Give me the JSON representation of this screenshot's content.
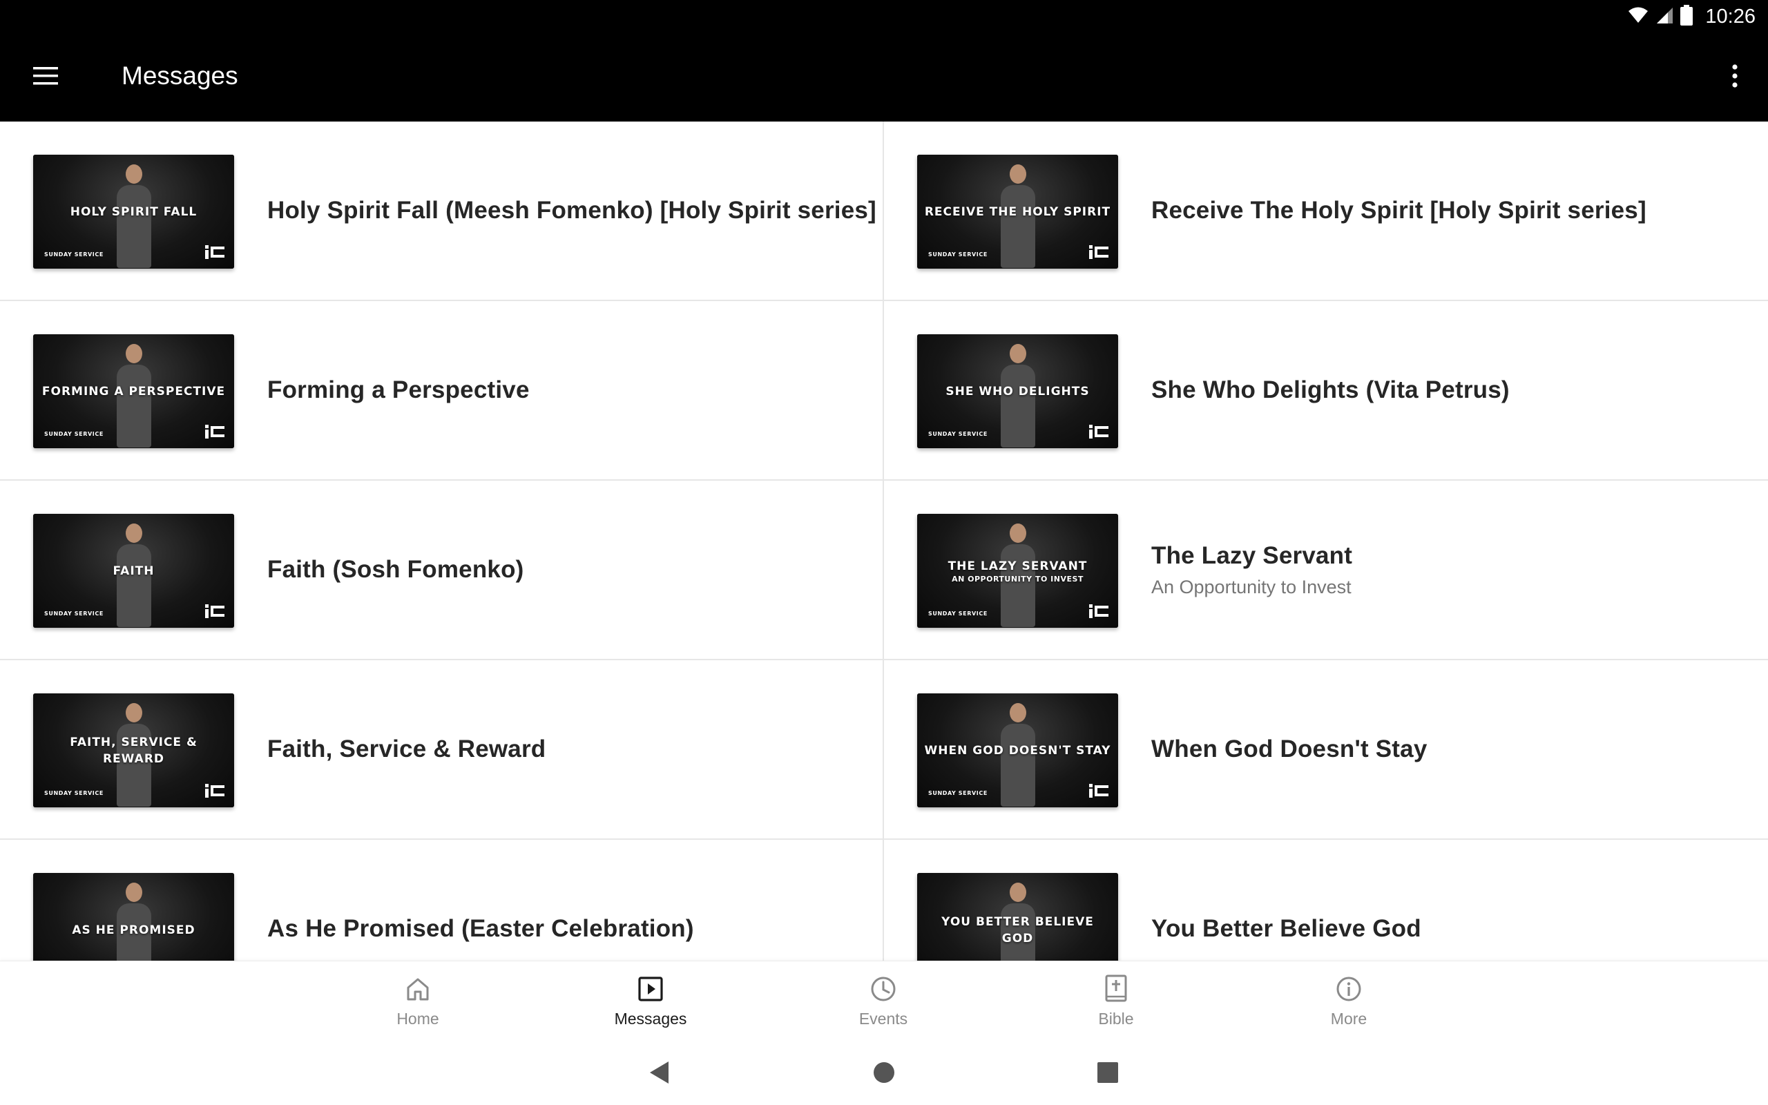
{
  "status_bar": {
    "time": "10:26",
    "icons": [
      "wifi-icon",
      "signal-icon",
      "battery-icon"
    ]
  },
  "app_bar": {
    "title": "Messages",
    "menu_icon": "menu-icon",
    "overflow_icon": "more-vert-icon"
  },
  "messages": [
    {
      "title": "Holy Spirit Fall (Meesh Fomenko) [Holy Spirit series]",
      "subtitle": "",
      "thumb_title": "HOLY SPIRIT FALL",
      "thumb_subtitle": "",
      "thumb_caption": "SUNDAY SERVICE"
    },
    {
      "title": "Receive The Holy Spirit [Holy Spirit series]",
      "subtitle": "",
      "thumb_title": "RECEIVE THE HOLY SPIRIT",
      "thumb_subtitle": "",
      "thumb_caption": "SUNDAY SERVICE"
    },
    {
      "title": "Forming a Perspective",
      "subtitle": "",
      "thumb_title": "FORMING A PERSPECTIVE",
      "thumb_subtitle": "",
      "thumb_caption": "SUNDAY SERVICE"
    },
    {
      "title": "She Who Delights (Vita Petrus)",
      "subtitle": "",
      "thumb_title": "SHE WHO DELIGHTS",
      "thumb_subtitle": "",
      "thumb_caption": "SUNDAY SERVICE"
    },
    {
      "title": "Faith (Sosh Fomenko)",
      "subtitle": "",
      "thumb_title": "FAITH",
      "thumb_subtitle": "",
      "thumb_caption": "SUNDAY SERVICE"
    },
    {
      "title": "The Lazy Servant",
      "subtitle": "An Opportunity to Invest",
      "thumb_title": "THE LAZY SERVANT",
      "thumb_subtitle": "AN OPPORTUNITY TO INVEST",
      "thumb_caption": "SUNDAY SERVICE"
    },
    {
      "title": "Faith, Service & Reward",
      "subtitle": "",
      "thumb_title": "FAITH, SERVICE & REWARD",
      "thumb_subtitle": "",
      "thumb_caption": "SUNDAY SERVICE"
    },
    {
      "title": "When God Doesn't Stay",
      "subtitle": "",
      "thumb_title": "WHEN GOD DOESN'T STAY",
      "thumb_subtitle": "",
      "thumb_caption": "SUNDAY SERVICE"
    },
    {
      "title": "As He Promised (Easter Celebration)",
      "subtitle": "",
      "thumb_title": "AS HE PROMISED",
      "thumb_subtitle": "",
      "thumb_caption": ""
    },
    {
      "title": "You Better Believe God",
      "subtitle": "",
      "thumb_title": "YOU BETTER BELIEVE GOD",
      "thumb_subtitle": "",
      "thumb_caption": ""
    }
  ],
  "bottom_nav": [
    {
      "label": "Home",
      "icon": "home-icon",
      "active": false
    },
    {
      "label": "Messages",
      "icon": "play-box-icon",
      "active": true
    },
    {
      "label": "Events",
      "icon": "clock-icon",
      "active": false
    },
    {
      "label": "Bible",
      "icon": "bible-icon",
      "active": false
    },
    {
      "label": "More",
      "icon": "info-icon",
      "active": false
    }
  ],
  "system_nav": [
    "back-icon",
    "home-circle-icon",
    "recents-icon"
  ],
  "colors": {
    "app_bar_bg": "#000000",
    "title_text": "#262626",
    "subtitle_text": "#757575",
    "nav_inactive": "#8a8a8a",
    "nav_active": "#1a1a1a"
  }
}
